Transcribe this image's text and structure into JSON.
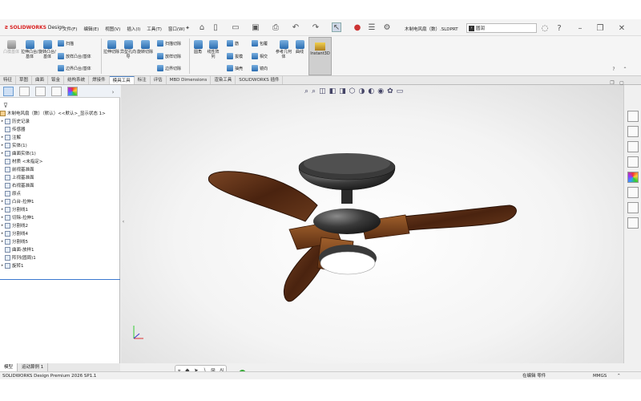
{
  "app": {
    "logo_text": "SOLIDWORKS",
    "logo_suffix": "Design",
    "document_title": "木制电风扇（数）.SLDPRT",
    "search_placeholder": "圆润",
    "search_icon": "search-icon"
  },
  "menu": [
    "文件(F)",
    "编辑(E)",
    "视图(V)",
    "插入(I)",
    "工具(T)",
    "窗口(W)"
  ],
  "ribbon": {
    "features": {
      "disabled_label": "凸模基体",
      "extrude_boss": "拉伸凸台/基体",
      "revolve_boss": "旋转凸台/基体",
      "sweep": "扫描",
      "loft": "放样凸台/基体",
      "boundary": "边界凸台/基体",
      "extrude_cut": "拉伸切除",
      "hole_wizard": "异型孔向导",
      "revolve_cut": "旋转切除",
      "sweep_cut": "扫描切除",
      "loft_cut": "放样切除",
      "boundary_cut": "边界切除",
      "fillet": "圆角",
      "linear_pattern": "线性阵列",
      "rib": "筋",
      "draft": "拔模",
      "shell": "抽壳",
      "wrap": "包覆",
      "intersect": "相交",
      "mirror": "镜向",
      "ref_geometry": "参考几何体",
      "curves": "曲线",
      "instant3d": "Instant3D"
    }
  },
  "tabs": [
    "特征",
    "草图",
    "曲面",
    "钣金",
    "结构系统",
    "焊接件",
    "模具工具",
    "标注",
    "评估",
    "MBD Dimensions",
    "渲染工具",
    "SOLIDWORKS 插件"
  ],
  "active_tab": "模具工具",
  "tree": {
    "root": "木制电风扇（数）（默认）<<默认>_显示状态 1>",
    "items": [
      {
        "label": "历史记录",
        "expand": "▸"
      },
      {
        "label": "传感器",
        "expand": ""
      },
      {
        "label": "注解",
        "expand": "▸"
      },
      {
        "label": "实体(1)",
        "expand": "▸"
      },
      {
        "label": "曲面实体(1)",
        "expand": "▸"
      },
      {
        "label": "材质 <未指定>",
        "expand": ""
      },
      {
        "label": "前视基准面",
        "expand": ""
      },
      {
        "label": "上视基准面",
        "expand": ""
      },
      {
        "label": "右视基准面",
        "expand": ""
      },
      {
        "label": "原点",
        "expand": ""
      },
      {
        "label": "凸台-拉伸1",
        "expand": "▸"
      },
      {
        "label": "分割线1",
        "expand": "▸"
      },
      {
        "label": "切除-拉伸1",
        "expand": "▸"
      },
      {
        "label": "分割线2",
        "expand": "▸"
      },
      {
        "label": "分割线4",
        "expand": "▸"
      },
      {
        "label": "分割线5",
        "expand": "▸"
      },
      {
        "label": "曲面-放样1",
        "expand": ""
      },
      {
        "label": "阵列(圆周)1",
        "expand": ""
      },
      {
        "label": "旋转1",
        "expand": "▸"
      }
    ]
  },
  "bottom_tabs": [
    "模型",
    "运动算例 1"
  ],
  "status": {
    "product": "SOLIDWORKS Design Premium 2026 SP1.1",
    "edit_state": "在编辑 零件",
    "units": "MMGS"
  },
  "colors": {
    "wood": "#5a2d14",
    "metal": "#2b2b2b",
    "accent": "#d92020",
    "selection": "#3b78d0"
  }
}
